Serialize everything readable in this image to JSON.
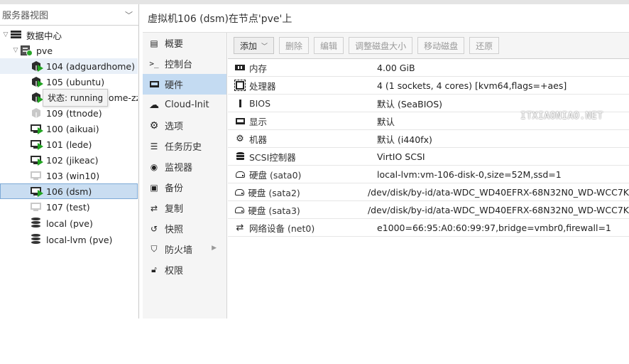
{
  "left": {
    "view_selector": "服务器视图",
    "tree": [
      {
        "label": "数据中心",
        "kind": "datacenter"
      },
      {
        "label": "pve",
        "kind": "node"
      },
      {
        "label": "104 (adguardhome)",
        "kind": "ct-running"
      },
      {
        "label": "105 (ubuntu)",
        "kind": "ct-running"
      },
      {
        "label": "home-zz",
        "kind": "ct-running"
      },
      {
        "label": "109 (ttnode)",
        "kind": "ct-stopped"
      },
      {
        "label": "100 (aikuai)",
        "kind": "vm-running"
      },
      {
        "label": "101 (lede)",
        "kind": "vm-running"
      },
      {
        "label": "102 (jikeac)",
        "kind": "vm-running"
      },
      {
        "label": "103 (win10)",
        "kind": "vm-stopped"
      },
      {
        "label": "106 (dsm)",
        "kind": "vm-running"
      },
      {
        "label": "107 (test)",
        "kind": "vm-stopped"
      },
      {
        "label": "local (pve)",
        "kind": "storage"
      },
      {
        "label": "local-lvm (pve)",
        "kind": "storage"
      }
    ],
    "tooltip": "状态: running"
  },
  "header": {
    "title": "虚拟机106 (dsm)在节点'pve'上"
  },
  "nav": [
    {
      "label": "概要",
      "icon": "book-icon"
    },
    {
      "label": "控制台",
      "icon": "terminal-icon"
    },
    {
      "label": "硬件",
      "icon": "desktop-icon"
    },
    {
      "label": "Cloud-Init",
      "icon": "cloud-icon"
    },
    {
      "label": "选项",
      "icon": "gear-icon"
    },
    {
      "label": "任务历史",
      "icon": "list-icon"
    },
    {
      "label": "监视器",
      "icon": "eye-icon"
    },
    {
      "label": "备份",
      "icon": "floppy-icon"
    },
    {
      "label": "复制",
      "icon": "retweet-icon"
    },
    {
      "label": "快照",
      "icon": "history-icon"
    },
    {
      "label": "防火墙",
      "icon": "shield-icon"
    },
    {
      "label": "权限",
      "icon": "unlock-icon"
    }
  ],
  "toolbar": {
    "add": "添加",
    "remove": "删除",
    "edit": "编辑",
    "resize": "调整磁盘大小",
    "move": "移动磁盘",
    "revert": "还原"
  },
  "hardware": [
    {
      "name": "内存",
      "value": "4.00 GiB",
      "icon": "memory-icon"
    },
    {
      "name": "处理器",
      "value": "4 (1 sockets, 4 cores) [kvm64,flags=+aes]",
      "icon": "cpu-icon"
    },
    {
      "name": "BIOS",
      "value": "默认 (SeaBIOS)",
      "icon": "bios-icon"
    },
    {
      "name": "显示",
      "value": "默认",
      "icon": "display-icon"
    },
    {
      "name": "机器",
      "value": "默认 (i440fx)",
      "icon": "cogs-icon"
    },
    {
      "name": "SCSI控制器",
      "value": "VirtIO SCSI",
      "icon": "database-icon"
    },
    {
      "name": "硬盘 (sata0)",
      "value": "local-lvm:vm-106-disk-0,size=52M,ssd=1",
      "icon": "hdd-icon"
    },
    {
      "name": "硬盘 (sata2)",
      "value": "/dev/disk/by-id/ata-WDC_WD40EFRX-68N32N0_WD-WCC7K",
      "icon": "hdd-icon"
    },
    {
      "name": "硬盘 (sata3)",
      "value": "/dev/disk/by-id/ata-WDC_WD40EFRX-68N32N0_WD-WCC7K",
      "icon": "hdd-icon"
    },
    {
      "name": "网络设备 (net0)",
      "value": "e1000=66:95:A0:60:99:97,bridge=vmbr0,firewall=1",
      "icon": "exchange-icon"
    }
  ],
  "watermark": "ITXIAONIAO.NET",
  "colors": {
    "running": "#21a321",
    "selected": "#c9ddf1",
    "nav_active": "#c4dbf2"
  }
}
